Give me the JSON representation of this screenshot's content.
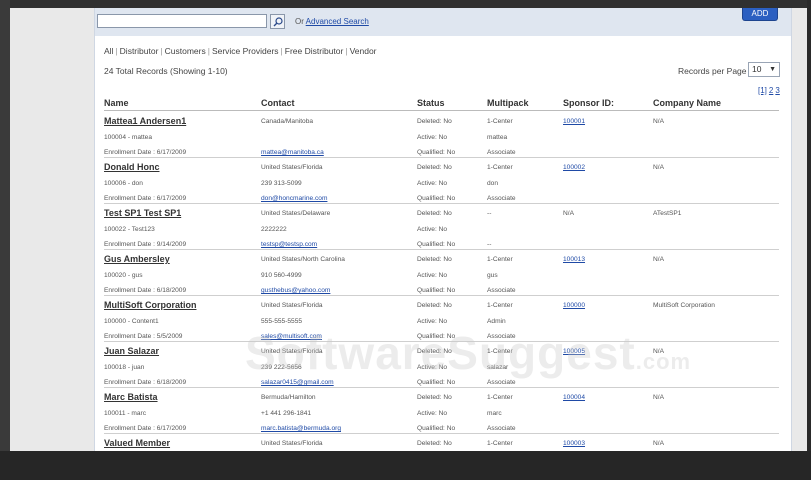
{
  "search": {
    "or_text": "Or",
    "advanced_link": "Advanced Search",
    "add_label": "ADD"
  },
  "filters": [
    "All",
    "Distributor",
    "Customers",
    "Service Providers",
    "Free Distributor",
    "Vendor"
  ],
  "total_records": "24 Total Records (Showing 1-10)",
  "records_per_page": {
    "label": "Records per Page",
    "value": "10"
  },
  "pager": [
    "[1]",
    "2",
    "3"
  ],
  "headers": {
    "name": "Name",
    "contact": "Contact",
    "status": "Status",
    "multipack": "Multipack",
    "sponsor": "Sponsor ID:",
    "company": "Company Name"
  },
  "records": [
    {
      "name": "Mattea1 Andersen1",
      "id_line": "100004 - mattea",
      "enroll": "Enrollment Date : 6/17/2009",
      "location": "Canada/Manitoba",
      "phone": "",
      "email": "mattea@manitoba.ca",
      "deleted": "Deleted: No",
      "active": "Active: No",
      "qualified": "Qualified: No",
      "mp1": "1-Center",
      "mp2": "mattea",
      "mp3": "Associate",
      "sponsor": "100001",
      "company": "N/A"
    },
    {
      "name": "Donald Honc",
      "id_line": "100006 - don",
      "enroll": "Enrollment Date : 6/17/2009",
      "location": "United States/Florida",
      "phone": "239 313-5099",
      "email": "don@honcmarine.com",
      "deleted": "Deleted: No",
      "active": "Active: No",
      "qualified": "Qualified: No",
      "mp1": "1-Center",
      "mp2": "don",
      "mp3": "Associate",
      "sponsor": "100002",
      "company": "N/A"
    },
    {
      "name": "Test SP1 Test SP1",
      "id_line": "100022 - Test123",
      "enroll": "Enrollment Date : 9/14/2009",
      "location": "United States/Delaware",
      "phone": "2222222",
      "email": "testsp@testsp.com",
      "deleted": "Deleted: No",
      "active": "Active: No",
      "qualified": "Qualified: No",
      "mp1": "--",
      "mp2": "",
      "mp3": "--",
      "sponsor": "N/A",
      "company": "ATestSP1"
    },
    {
      "name": "Gus Ambersley",
      "id_line": "100020 - gus",
      "enroll": "Enrollment Date : 6/18/2009",
      "location": "United States/North Carolina",
      "phone": "910 560-4999",
      "email": "gusthebus@yahoo.com",
      "deleted": "Deleted: No",
      "active": "Active: No",
      "qualified": "Qualified: No",
      "mp1": "1-Center",
      "mp2": "gus",
      "mp3": "Associate",
      "sponsor": "100013",
      "company": "N/A"
    },
    {
      "name": "MultiSoft Corporation",
      "id_line": "100000 - Content1",
      "enroll": "Enrollment Date : 5/5/2009",
      "location": "United States/Florida",
      "phone": "555-555-5555",
      "email": "sales@multisoft.com",
      "deleted": "Deleted: No",
      "active": "Active: No",
      "qualified": "Qualified: No",
      "mp1": "1-Center",
      "mp2": "Admin",
      "mp3": "Associate",
      "sponsor": "100000",
      "company": "MultiSoft Corporation"
    },
    {
      "name": "Juan Salazar",
      "id_line": "100018 - juan",
      "enroll": "Enrollment Date : 6/18/2009",
      "location": "United States/Florida",
      "phone": "239 222-5656",
      "email": "salazar0415@gmail.com",
      "deleted": "Deleted: No",
      "active": "Active: No",
      "qualified": "Qualified: No",
      "mp1": "1-Center",
      "mp2": "salazar",
      "mp3": "Associate",
      "sponsor": "100005",
      "company": "N/A"
    },
    {
      "name": "Marc Batista",
      "id_line": "100011 - marc",
      "enroll": "Enrollment Date : 6/17/2009",
      "location": "Bermuda/Hamilton",
      "phone": "+1 441 296-1841",
      "email": "marc.batista@bermuda.org",
      "deleted": "Deleted: No",
      "active": "Active: No",
      "qualified": "Qualified: No",
      "mp1": "1-Center",
      "mp2": "marc",
      "mp3": "Associate",
      "sponsor": "100004",
      "company": "N/A"
    },
    {
      "name": "Valued Member",
      "id_line": "",
      "enroll": "",
      "location": "United States/Florida",
      "phone": "",
      "email": "",
      "deleted": "Deleted: No",
      "active": "",
      "qualified": "",
      "mp1": "1-Center",
      "mp2": "",
      "mp3": "",
      "sponsor": "100003",
      "company": "N/A"
    }
  ],
  "watermark": {
    "main": "SoftwareSuggest",
    "suffix": ".com"
  }
}
